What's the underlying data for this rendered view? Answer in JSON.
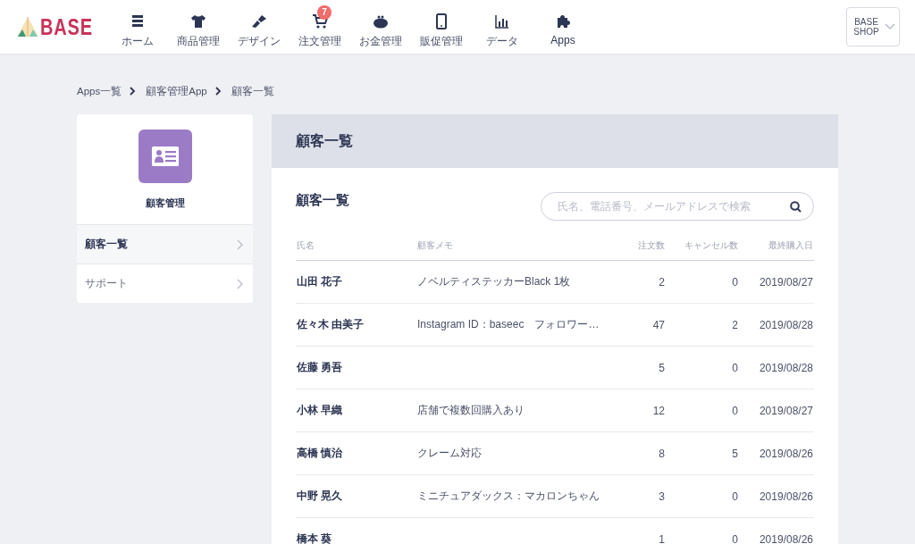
{
  "header": {
    "logo": "BASE",
    "nav": [
      {
        "label": "ホーム",
        "selected": false
      },
      {
        "label": "商品管理",
        "selected": false
      },
      {
        "label": "デザイン",
        "selected": false
      },
      {
        "label": "注文管理",
        "badge": "7",
        "selected": false
      },
      {
        "label": "お金管理",
        "selected": false
      },
      {
        "label": "販促管理",
        "selected": false
      },
      {
        "label": "データ",
        "selected": false
      },
      {
        "label": "Apps",
        "selected": true
      }
    ],
    "shop": "BASE SHOP"
  },
  "breadcrumb": [
    "Apps一覧",
    "顧客管理App",
    "顧客一覧"
  ],
  "sidebar": {
    "app_name": "顧客管理",
    "items": [
      {
        "label": "顧客一覧",
        "selected": true
      },
      {
        "label": "サポート",
        "selected": false
      }
    ]
  },
  "main": {
    "page_title": "顧客一覧",
    "section_title": "顧客一覧",
    "search": {
      "placeholder": "氏名、電話番号、メールアドレスで検索"
    },
    "table": {
      "columns": [
        "氏名",
        "顧客メモ",
        "注文数",
        "キャンセル数",
        "最終購入日"
      ],
      "rows": [
        [
          "山田 花子",
          "ノベルティステッカーBlack 1枚",
          "2",
          "0",
          "2019/08/27"
        ],
        [
          "佐々木 由美子",
          "Instagram ID：baseec　フォロワー…",
          "47",
          "2",
          "2019/08/28"
        ],
        [
          "佐藤 勇吾",
          "",
          "5",
          "0",
          "2019/08/28"
        ],
        [
          "小林 早織",
          "店舗で複数回購入あり",
          "12",
          "0",
          "2019/08/27"
        ],
        [
          "高橋 慎治",
          "クレーム対応",
          "8",
          "5",
          "2019/08/26"
        ],
        [
          "中野 晃久",
          "ミニチュアダックス：マカロンちゃん",
          "3",
          "0",
          "2019/08/26"
        ],
        [
          "橋本 葵",
          "",
          "1",
          "0",
          "2019/08/26"
        ]
      ]
    }
  }
}
